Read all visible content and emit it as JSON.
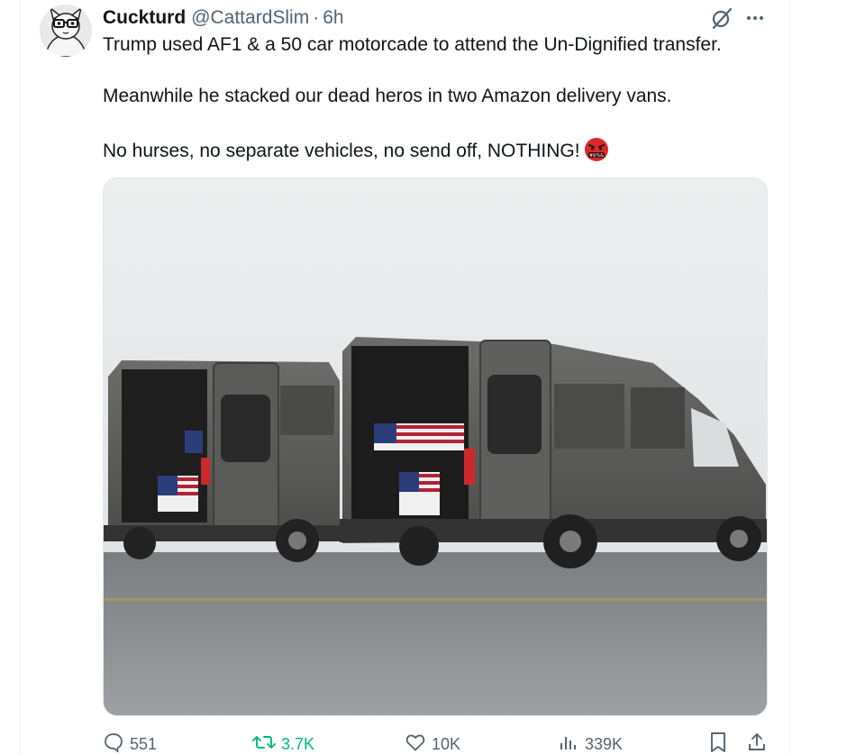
{
  "tweet": {
    "author": {
      "display_name": "Cuckturd",
      "handle": "@CattardSlim",
      "separator": "·",
      "time": "6h"
    },
    "text_lines": [
      "Trump used AF1 & a 50 car motorcade  to attend the Un-Dignified transfer.",
      "Meanwhile he stacked our dead heros in two Amazon delivery vans.",
      "No hurses, no separate vehicles, no send off, NOTHING!"
    ],
    "emoji": "face-with-symbols-on-mouth",
    "metrics": {
      "replies": "551",
      "retweets": "3.7K",
      "likes": "10K",
      "views": "339K"
    }
  },
  "colors": {
    "text": "#0f1419",
    "secondary": "#536471",
    "retweet_green": "#00ba7c",
    "border": "#eff3f4"
  },
  "icons": [
    "grok-icon",
    "more-icon",
    "reply-icon",
    "retweet-icon",
    "like-icon",
    "views-icon",
    "bookmark-icon",
    "share-icon"
  ]
}
